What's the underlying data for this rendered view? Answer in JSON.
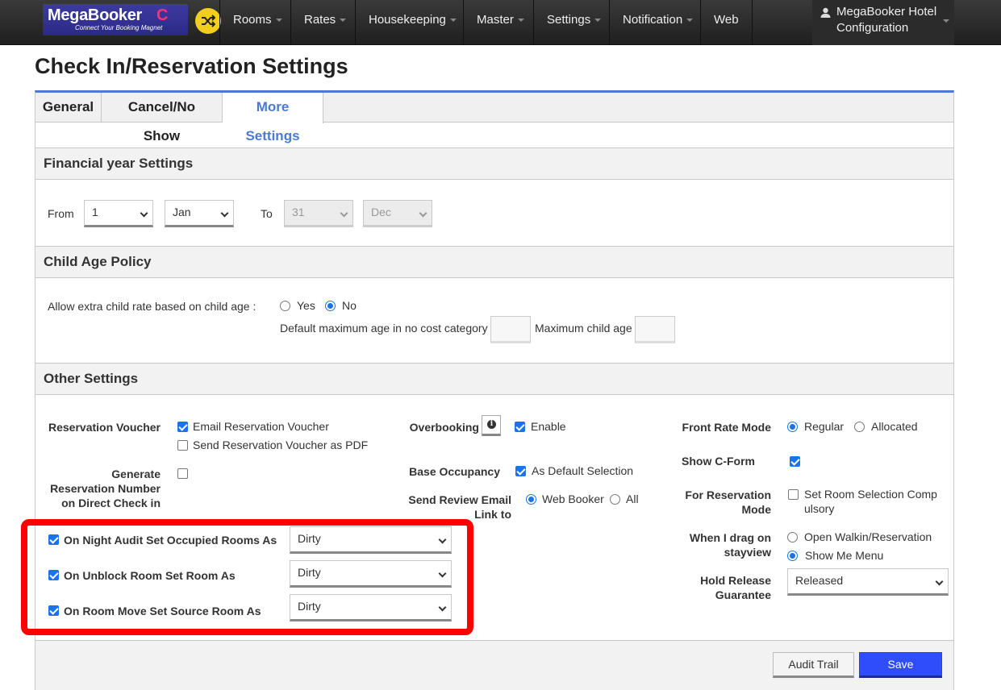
{
  "navbar": {
    "logo_text": "MegaBooker",
    "logo_mark": "C",
    "logo_tagline": "Connect Your Booking Magnet",
    "shuffle_icon": "shuffle-icon",
    "menu": [
      {
        "label": "Rooms"
      },
      {
        "label": "Rates"
      },
      {
        "label": "Housekeeping"
      },
      {
        "label": "Master"
      },
      {
        "label": "Settings"
      },
      {
        "label": "Notification"
      },
      {
        "label": "Web"
      }
    ],
    "user_line1": "MegaBooker Hotel",
    "user_line2": "Configuration"
  },
  "page_title": "Check In/Reservation Settings",
  "tabs": [
    {
      "label": "General",
      "active": false
    },
    {
      "label": "Cancel/No Show",
      "active": false
    },
    {
      "label": "More Settings",
      "active": true
    }
  ],
  "financial": {
    "heading": "Financial year Settings",
    "from_label": "From",
    "from_day": "1",
    "from_month": "Jan",
    "to_label": "To",
    "to_day": "31",
    "to_month": "Dec"
  },
  "child_age": {
    "heading": "Child Age Policy",
    "extra_rate_label": "Allow extra child rate based on child age :",
    "yes_label": "Yes",
    "no_label": "No",
    "selected": "No",
    "default_max_age_label": "Default maximum age in no cost category",
    "default_max_age_value": "",
    "max_child_age_label": "Maximum child age",
    "max_child_age_value": ""
  },
  "other": {
    "heading": "Other Settings",
    "reservation_voucher_label": "Reservation Voucher",
    "email_voucher_label": "Email Reservation Voucher",
    "email_voucher_checked": true,
    "pdf_voucher_label": "Send Reservation Voucher as PDF",
    "pdf_voucher_checked": false,
    "generate_number_label_1": "Generate",
    "generate_number_label_2": "Reservation Number",
    "generate_number_label_3": "on Direct Check in",
    "generate_number_checked": false,
    "night_audit_label": "On Night Audit Set Occupied Rooms As",
    "night_audit_value": "Dirty",
    "unblock_label": "On Unblock Room Set Room As",
    "unblock_value": "Dirty",
    "room_move_label": "On Room Move Set Source Room As",
    "room_move_value": "Dirty",
    "overbooking_label": "Overbooking",
    "overbooking_enable_label": "Enable",
    "base_occupancy_label": "Base Occupancy",
    "base_occupancy_option": "As Default Selection",
    "review_email_label_1": "Send Review Email",
    "review_email_label_2": "Link to",
    "review_web_booker": "Web Booker",
    "review_all": "All",
    "front_rate_label": "Front Rate Mode",
    "front_rate_regular": "Regular",
    "front_rate_allocated": "Allocated",
    "cform_label": "Show C-Form",
    "reservation_mode_label_1": "For Reservation",
    "reservation_mode_label_2": "Mode",
    "room_selection_line1": "Set Room Selection Comp",
    "room_selection_line2": "ulsory",
    "drag_label_1": "When I drag on",
    "drag_label_2": "stayview",
    "drag_open": "Open Walkin/Reservation",
    "drag_menu": "Show Me Menu",
    "hold_release_label_1": "Hold Release",
    "hold_release_label_2": "Guarantee",
    "hold_release_value": "Released"
  },
  "footer": {
    "audit_trail_label": "Audit Trail",
    "save_label": "Save"
  }
}
